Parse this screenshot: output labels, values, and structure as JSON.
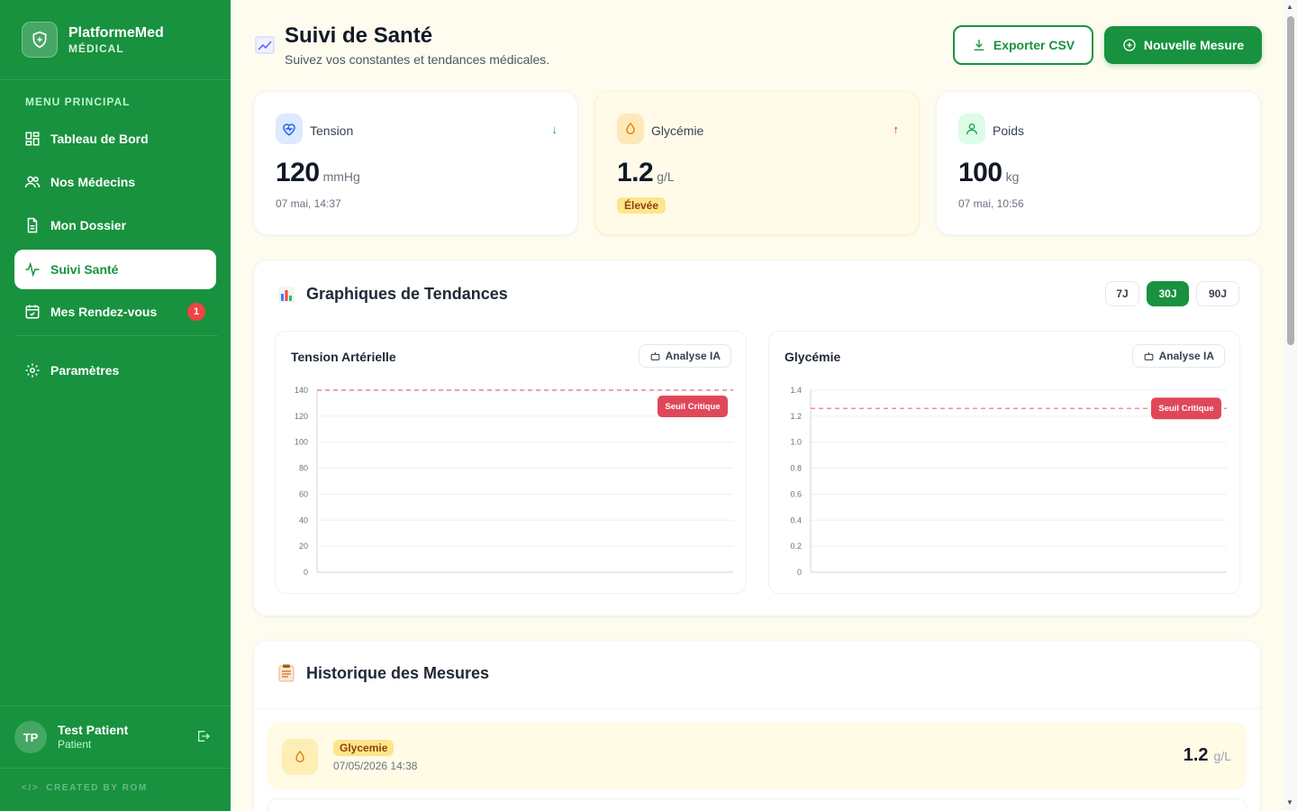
{
  "brand": {
    "name": "PlatformeMed",
    "subtitle": "MÉDICAL"
  },
  "sidebar": {
    "menu_title": "MENU PRINCIPAL",
    "items": [
      {
        "label": "Tableau de Bord",
        "icon": "dashboard-icon"
      },
      {
        "label": "Nos Médecins",
        "icon": "users-icon"
      },
      {
        "label": "Mon Dossier",
        "icon": "document-icon"
      },
      {
        "label": "Suivi Santé",
        "icon": "activity-icon",
        "active": true
      },
      {
        "label": "Mes Rendez-vous",
        "icon": "calendar-icon",
        "badge": "1"
      },
      {
        "label": "Paramètres",
        "icon": "gear-icon"
      }
    ],
    "user": {
      "initials": "TP",
      "name": "Test Patient",
      "role": "Patient"
    },
    "credit": "CREATED BY ROM"
  },
  "header": {
    "title": "Suivi de Santé",
    "subtitle": "Suivez vos constantes et tendances médicales.",
    "export_label": "Exporter CSV",
    "new_label": "Nouvelle Mesure"
  },
  "stats": [
    {
      "label": "Tension",
      "value": "120",
      "unit": "mmHg",
      "date": "07 mai, 14:37",
      "trend": "down",
      "icon": "heart-pulse-icon"
    },
    {
      "label": "Glycémie",
      "value": "1.2",
      "unit": "g/L",
      "badge": "Élevée",
      "trend": "up",
      "icon": "drop-icon"
    },
    {
      "label": "Poids",
      "value": "100",
      "unit": "kg",
      "date": "07 mai, 10:56",
      "icon": "person-icon"
    }
  ],
  "trends": {
    "title": "Graphiques de Tendances",
    "ranges": [
      "7J",
      "30J",
      "90J"
    ],
    "active_range": "30J",
    "ai_label": "Analyse IA",
    "threshold_label": "Seuil Critique"
  },
  "chart_data": [
    {
      "type": "line",
      "title": "Tension Artérielle",
      "ylim": [
        0,
        140
      ],
      "yticks": [
        0,
        20,
        40,
        60,
        80,
        100,
        120,
        140
      ],
      "threshold": 140,
      "threshold_label": "Seuil Critique",
      "series": [],
      "grid": true
    },
    {
      "type": "line",
      "title": "Glycémie",
      "ylim": [
        0,
        1.4
      ],
      "yticks": [
        "0",
        "0.2",
        "0.4",
        "0.6",
        "0.8",
        "1.0",
        "1.2",
        "1.4"
      ],
      "threshold": 1.26,
      "threshold_label": "Seuil Critique",
      "series": [],
      "grid": true
    }
  ],
  "history": {
    "title": "Historique des Mesures",
    "rows": [
      {
        "type": "Glycemie",
        "date": "07/05/2026 14:38",
        "value": "1.2",
        "unit": "g/L"
      }
    ]
  },
  "colors": {
    "primary": "#18923e",
    "danger": "#e74a5a",
    "warning": "#fde68a"
  }
}
